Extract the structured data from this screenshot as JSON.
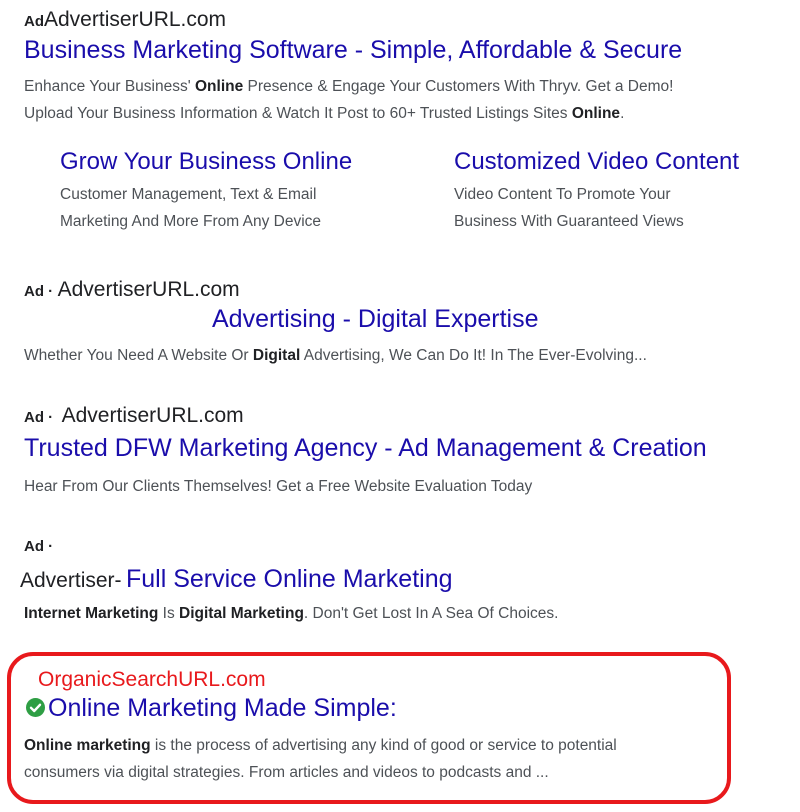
{
  "ads": [
    {
      "label": "Ad",
      "url": "AdvertiserURL.com",
      "title": "Business Marketing Software - Simple, Affordable & Secure",
      "desc_line1": {
        "pre": "Enhance Your Business' ",
        "bold": "Online",
        "post": " Presence & Engage Your Customers With Thryv. Get a Demo!"
      },
      "desc_line2": {
        "pre": "Upload Your Business Information & Watch It Post to 60+ Trusted Listings Sites ",
        "bold": "Online",
        "post": "."
      },
      "sitelinks": [
        {
          "title": "Grow Your Business Online",
          "line1": "Customer Management, Text & Email",
          "line2": "Marketing And More From Any Device"
        },
        {
          "title": "Customized Video Content",
          "line1": "Video Content To Promote Your",
          "line2": "Business With Guaranteed Views"
        }
      ]
    },
    {
      "label": "Ad ·",
      "url": "AdvertiserURL.com",
      "title": "Advertising - Digital Expertise",
      "desc": {
        "pre": "Whether You Need A Website Or ",
        "bold": "Digital",
        "post": " Advertising, We Can Do It! In The Ever-Evolving..."
      }
    },
    {
      "label": "Ad ·",
      "url": "AdvertiserURL.com",
      "title": "Trusted DFW Marketing Agency - Ad Management & Creation",
      "desc": "Hear From Our Clients Themselves! Get a Free Website Evaluation Today"
    },
    {
      "label": "Ad ·",
      "url": "Advertiser-",
      "title": "Full Service Online Marketing",
      "desc": {
        "b1": "Internet Marketing",
        "t1": " Is ",
        "b2": "Digital Marketing",
        "t2": ". Don't Get Lost In A Sea Of Choices."
      }
    }
  ],
  "organic": {
    "url": "OrganicSearchURL.com",
    "title": "Online Marketing Made Simple:",
    "line1_bold": "Online marketing",
    "line1_rest": " is the process of advertising any kind of good or service to potential",
    "line2": "consumers via digital strategies. From articles and videos to podcasts and ..."
  },
  "colors": {
    "link": "#1a0dab",
    "highlight": "#e8191c",
    "check": "#2e9e44"
  },
  "icons": {
    "verified": "check-circle-icon"
  }
}
